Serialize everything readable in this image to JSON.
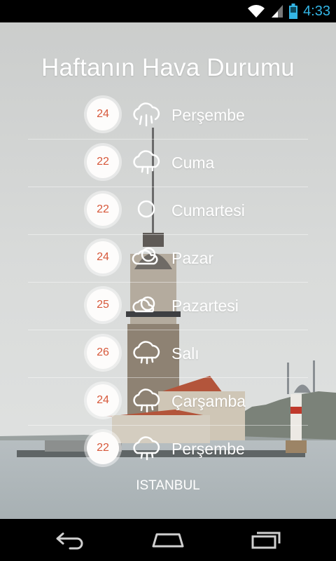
{
  "status_bar": {
    "time": "4:33",
    "icons": [
      "wifi-icon",
      "signal-icon",
      "battery-icon"
    ]
  },
  "title": "Haftanın Hava Durumu",
  "forecast": [
    {
      "temp": "24",
      "day": "Perşembe",
      "icon": "rain-cloud-icon"
    },
    {
      "temp": "22",
      "day": "Cuma",
      "icon": "rain-cloud-icon"
    },
    {
      "temp": "22",
      "day": "Cumartesi",
      "icon": "sun-icon"
    },
    {
      "temp": "24",
      "day": "Pazar",
      "icon": "partly-cloudy-icon"
    },
    {
      "temp": "25",
      "day": "Pazartesi",
      "icon": "partly-cloudy-icon"
    },
    {
      "temp": "26",
      "day": "Salı",
      "icon": "rain-cloud-icon"
    },
    {
      "temp": "24",
      "day": "Çarşamba",
      "icon": "rain-cloud-icon"
    },
    {
      "temp": "22",
      "day": "Perşembe",
      "icon": "rain-cloud-icon"
    }
  ],
  "city": "ISTANBUL",
  "nav": [
    "back-icon",
    "home-icon",
    "recent-apps-icon"
  ],
  "colors": {
    "temp_text": "#d7583a",
    "status_accent": "#33b5e5",
    "sky": "#d7d9d8",
    "water": "#b9c0c3"
  }
}
